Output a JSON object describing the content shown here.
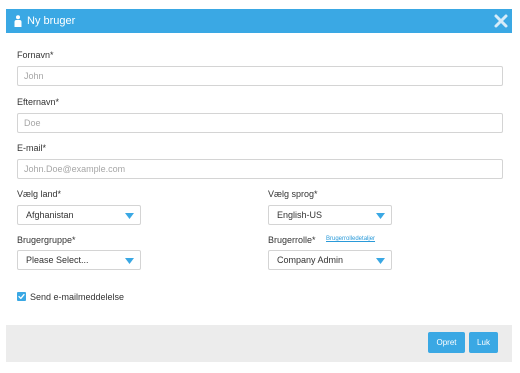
{
  "dialog": {
    "title": "Ny bruger",
    "icons": {
      "title": "user-icon",
      "close": "close-icon"
    }
  },
  "form": {
    "first_name": {
      "label": "Fornavn*",
      "placeholder": "John",
      "value": ""
    },
    "last_name": {
      "label": "Efternavn*",
      "placeholder": "Doe",
      "value": ""
    },
    "email": {
      "label": "E-mail*",
      "placeholder": "John.Doe@example.com",
      "value": ""
    },
    "country": {
      "label": "Vælg land*",
      "selected": "Afghanistan"
    },
    "language": {
      "label": "Vælg sprog*",
      "selected": "English-US"
    },
    "user_group": {
      "label": "Brugergruppe*",
      "selected": "Please Select..."
    },
    "user_role": {
      "label": "Brugerrolle*",
      "selected": "Company Admin",
      "details_link": "Brugerrolledetaljer"
    },
    "send_email": {
      "label": "Send e-mailmeddelelse",
      "checked": true
    }
  },
  "footer": {
    "create_label": "Opret",
    "close_label": "Luk"
  },
  "colors": {
    "accent": "#3aa8e4",
    "footer_bg": "#ececec",
    "input_border": "#d4d4d4"
  }
}
